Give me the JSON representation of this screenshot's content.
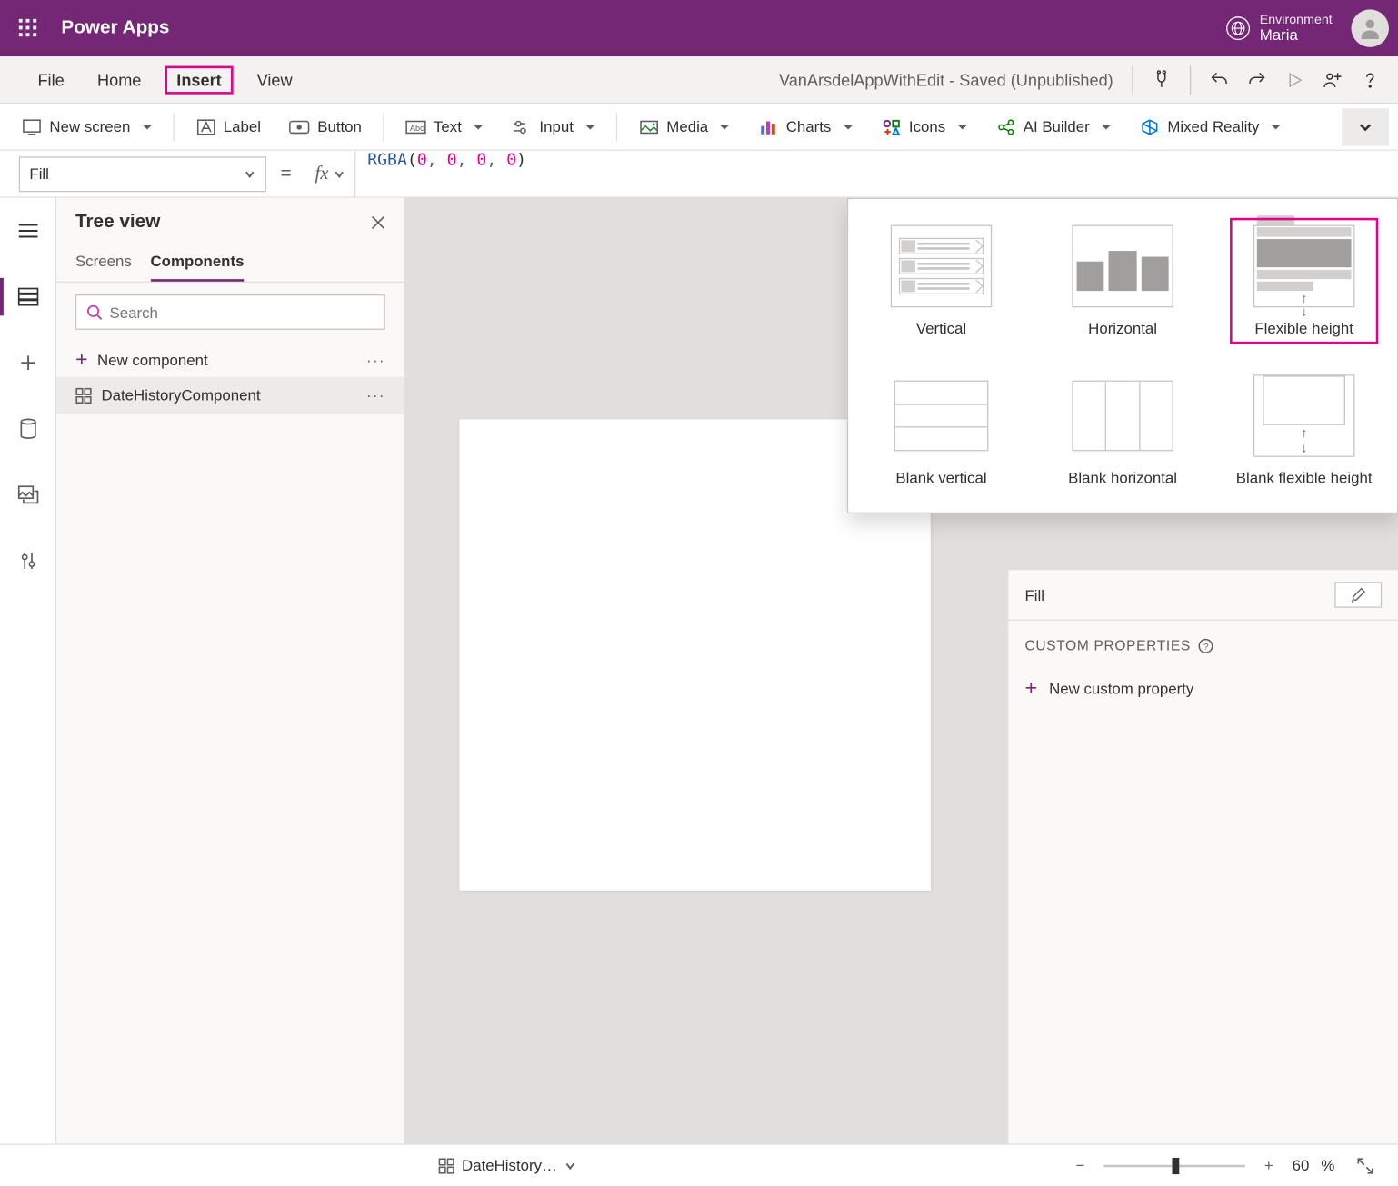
{
  "titlebar": {
    "product": "Power Apps",
    "env_label": "Environment",
    "env_value": "Maria"
  },
  "menubar": {
    "items": [
      "File",
      "Home",
      "Insert",
      "View"
    ],
    "active": "Insert",
    "app_status": "VanArsdelAppWithEdit - Saved (Unpublished)"
  },
  "ribbon": {
    "new_screen": "New screen",
    "label": "Label",
    "button": "Button",
    "text": "Text",
    "input": "Input",
    "media": "Media",
    "charts": "Charts",
    "icons": "Icons",
    "ai_builder": "AI Builder",
    "mixed_reality": "Mixed Reality"
  },
  "formulabar": {
    "property": "Fill",
    "formula_fn": "RGBA",
    "formula_args": [
      "0",
      "0",
      "0",
      "0"
    ]
  },
  "tree": {
    "title": "Tree view",
    "tabs": {
      "screens": "Screens",
      "components": "Components"
    },
    "active_tab": "Components",
    "search_placeholder": "Search",
    "new_component": "New component",
    "items": [
      "DateHistoryComponent"
    ]
  },
  "gallery": {
    "items": [
      {
        "label": "Vertical",
        "thumb": "vertical"
      },
      {
        "label": "Horizontal",
        "thumb": "horizontal"
      },
      {
        "label": "Flexible height",
        "thumb": "flex",
        "highlight": true
      },
      {
        "label": "Blank vertical",
        "thumb": "blank-v"
      },
      {
        "label": "Blank horizontal",
        "thumb": "blank-h"
      },
      {
        "label": "Blank flexible height",
        "thumb": "blank-flex"
      }
    ]
  },
  "props": {
    "fill_label": "Fill",
    "section": "CUSTOM PROPERTIES",
    "new_prop": "New custom property"
  },
  "statusbar": {
    "component": "DateHistory…",
    "zoom": "60",
    "zoom_unit": "%"
  }
}
